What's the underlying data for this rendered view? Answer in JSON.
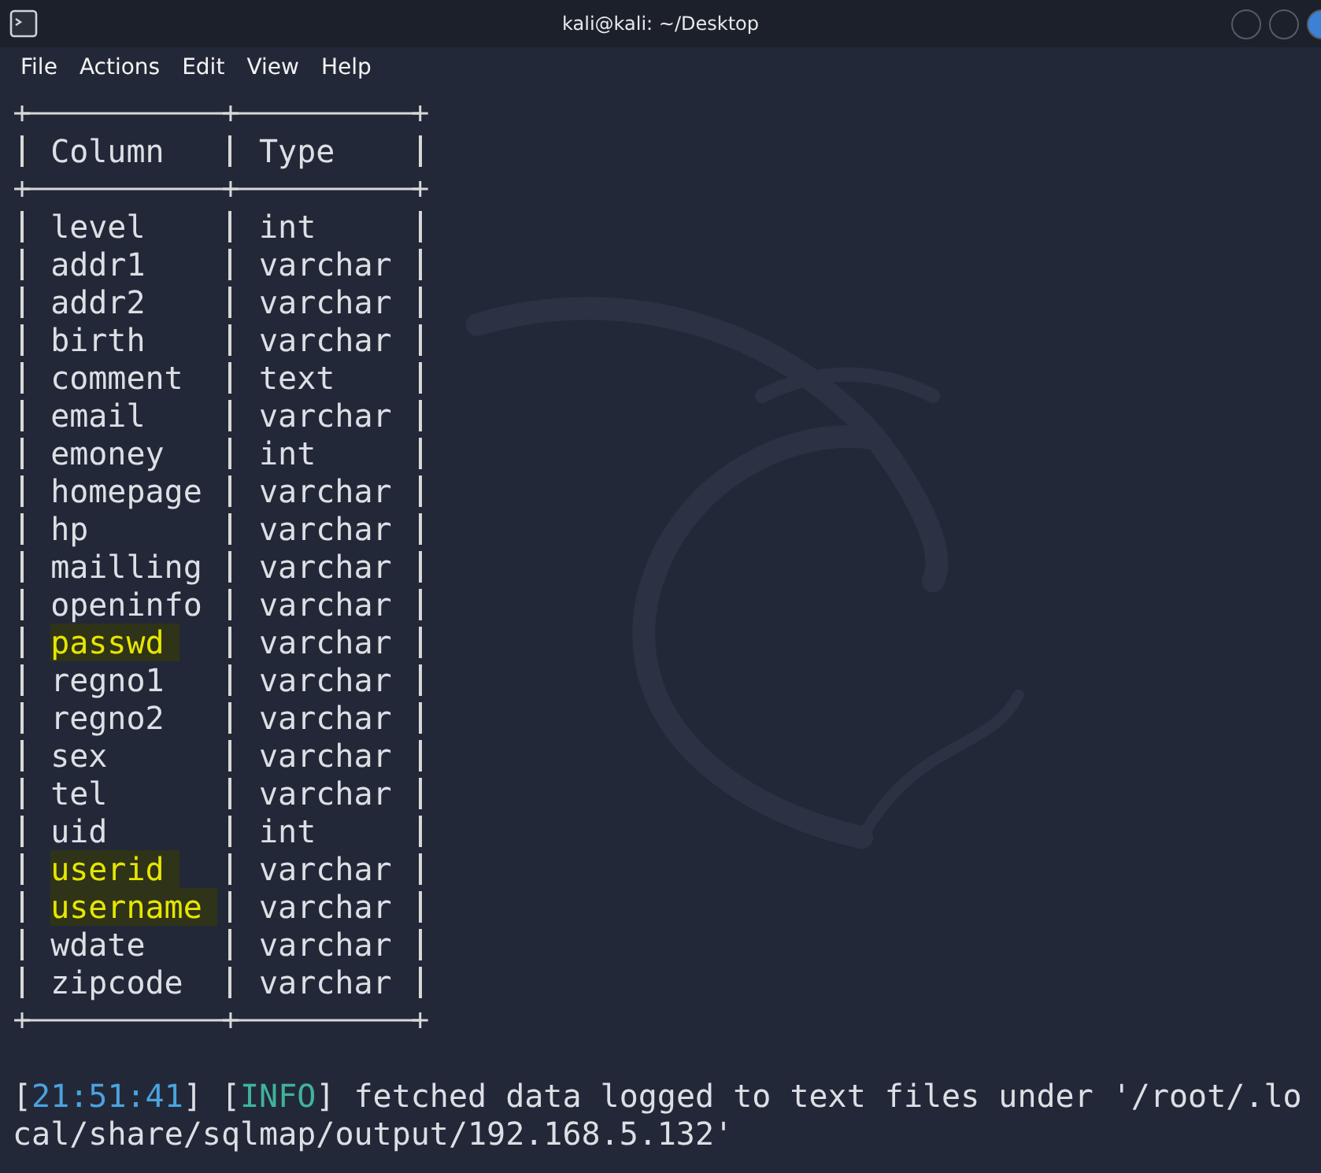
{
  "window": {
    "title": "kali@kali: ~/Desktop"
  },
  "menu": [
    "File",
    "Actions",
    "Edit",
    "View",
    "Help"
  ],
  "table": {
    "columns": [
      "Column",
      "Type"
    ],
    "rows": [
      {
        "column": "level",
        "type": "int",
        "highlighted": false
      },
      {
        "column": "addr1",
        "type": "varchar",
        "highlighted": false
      },
      {
        "column": "addr2",
        "type": "varchar",
        "highlighted": false
      },
      {
        "column": "birth",
        "type": "varchar",
        "highlighted": false
      },
      {
        "column": "comment",
        "type": "text",
        "highlighted": false
      },
      {
        "column": "email",
        "type": "varchar",
        "highlighted": false
      },
      {
        "column": "emoney",
        "type": "int",
        "highlighted": false
      },
      {
        "column": "homepage",
        "type": "varchar",
        "highlighted": false
      },
      {
        "column": "hp",
        "type": "varchar",
        "highlighted": false
      },
      {
        "column": "mailling",
        "type": "varchar",
        "highlighted": false
      },
      {
        "column": "openinfo",
        "type": "varchar",
        "highlighted": false
      },
      {
        "column": "passwd",
        "type": "varchar",
        "highlighted": true
      },
      {
        "column": "regno1",
        "type": "varchar",
        "highlighted": false
      },
      {
        "column": "regno2",
        "type": "varchar",
        "highlighted": false
      },
      {
        "column": "sex",
        "type": "varchar",
        "highlighted": false
      },
      {
        "column": "tel",
        "type": "varchar",
        "highlighted": false
      },
      {
        "column": "uid",
        "type": "int",
        "highlighted": false
      },
      {
        "column": "userid",
        "type": "varchar",
        "highlighted": true
      },
      {
        "column": "username",
        "type": "varchar",
        "highlighted": true
      },
      {
        "column": "wdate",
        "type": "varchar",
        "highlighted": false
      },
      {
        "column": "zipcode",
        "type": "varchar",
        "highlighted": false
      }
    ]
  },
  "log": {
    "segments": [
      {
        "kind": "plain",
        "text": "["
      },
      {
        "kind": "time",
        "text": "21:51:41"
      },
      {
        "kind": "plain",
        "text": "] ["
      },
      {
        "kind": "level",
        "text": "INFO"
      },
      {
        "kind": "plain",
        "text": "] fetched data logged to text files under '/root/.local/share/sqlmap/output/192.168.5.132'"
      }
    ]
  }
}
